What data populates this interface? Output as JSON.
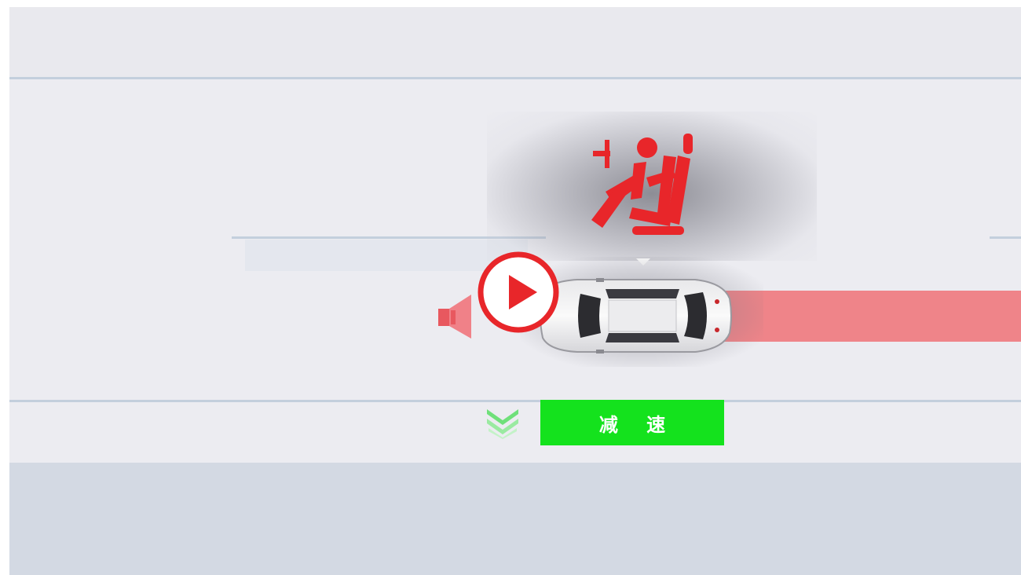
{
  "player": {
    "play_icon": "play-icon"
  },
  "warning": {
    "icon": "seatbelt-warning-icon",
    "color": "#e8262a"
  },
  "alert": {
    "sound_icon": "speaker-icon",
    "lane_color": "#ef8489"
  },
  "action": {
    "icon": "double-chevron-down-icon",
    "label": "减 速",
    "color": "#14e21d"
  },
  "vehicle": {
    "icon": "car-top-view"
  }
}
